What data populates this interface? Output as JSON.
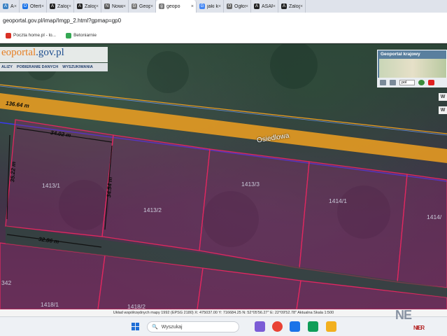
{
  "browser": {
    "tabs": [
      {
        "label": "ArcGIS",
        "color": "#3b82c4",
        "glyph": "A"
      },
      {
        "label": "Oferta",
        "color": "#1a73e8",
        "glyph": "O"
      },
      {
        "label": "Zalogi",
        "color": "#222222",
        "glyph": "A"
      },
      {
        "label": "Zalogi",
        "color": "#222222",
        "glyph": "A"
      },
      {
        "label": "Nowa",
        "color": "#555555",
        "glyph": "N"
      },
      {
        "label": "Geopo",
        "color": "#777777",
        "glyph": "G"
      },
      {
        "label": "geopo",
        "color": "#777777",
        "glyph": "g",
        "active": true
      },
      {
        "label": "jaki ko",
        "color": "#4285f4",
        "glyph": "G"
      },
      {
        "label": "Ogłos",
        "color": "#666666",
        "glyph": "O"
      },
      {
        "label": "ASARI",
        "color": "#222222",
        "glyph": "A"
      },
      {
        "label": "Zalogi",
        "color": "#222222",
        "glyph": "A"
      }
    ],
    "close_glyph": "×",
    "url": "geoportal.gov.pl/imap/Imgp_2.html?gpmap=gp0",
    "bookmarks": [
      {
        "label": "Poczta home.pl - lo...",
        "color": "#d93025"
      },
      {
        "label": "Betoniarnie",
        "color": "#34a853"
      }
    ]
  },
  "map": {
    "brand_part1": "eoportal",
    "brand_part2": ".gov.pl",
    "menu": [
      "ALIZY",
      "POBIERANIE DANYCH",
      "WYSZUKIWANIA"
    ],
    "minimap_title": "Geoportal krajowy",
    "lang_value": "pol",
    "side_buttons": [
      "W",
      "W"
    ],
    "street_name": "Osiedlowa",
    "measurements": [
      "136.64 m",
      "34.02 m",
      "35.22 m",
      "34.54 m",
      "32.86 m"
    ],
    "plots": [
      "1413/1",
      "1413/2",
      "1413/3",
      "1414/1",
      "1414/",
      "1418/1",
      "1418/2",
      "342"
    ]
  },
  "statusbar": {
    "text": "Układ współrzędnych mapy 1992 (EPSG 2180)  X: 475037.00  Y: 716684.25   N: 52°05'56.27\"  E: 22°09'52.78\"   Aktualna Skala 1:500"
  },
  "taskbar": {
    "search_placeholder": "Wyszukaj",
    "apps": [
      "#7b5cd6",
      "#e94235",
      "#1a73e8",
      "#0f9d58",
      "#f2b01e"
    ],
    "logo_text": "NE",
    "logo_sub": "NIER"
  },
  "colors": {
    "parcel": "#e0285f",
    "road": "#f0a020",
    "boundary": "#3a3af0"
  }
}
